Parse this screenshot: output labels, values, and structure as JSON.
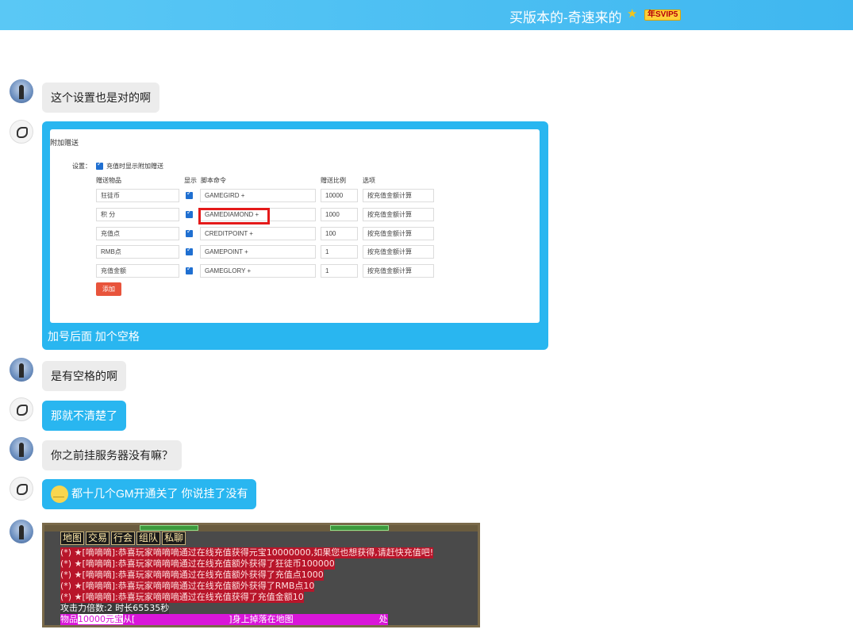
{
  "header": {
    "title": "买版本的-奇速来的",
    "vip_badge": "年SVIP5"
  },
  "messages": {
    "m1": "这个设置也是对的啊",
    "m2_caption": "加号后面 加个空格",
    "m3": "是有空格的啊",
    "m4": "那就不清楚了",
    "m5": "你之前挂服务器没有嘛？",
    "m6": "都十几个GM开通关了 你说挂了没有"
  },
  "screenshot_form": {
    "section_title": "附加赠送",
    "setting_label": "设置：",
    "setting_option": "充值时显示附加赠送",
    "col_item": "赠送物品",
    "col_show": "显示",
    "col_script": "脚本命令",
    "col_ratio": "赠送比例",
    "col_option": "选项",
    "rows": [
      {
        "item": "狂徒币",
        "script": "GAMEGIRD +",
        "ratio": "10000",
        "option": "按充值金额计算"
      },
      {
        "item": "积 分",
        "script": "GAMEDIAMOND +",
        "ratio": "1000",
        "option": "按充值金额计算"
      },
      {
        "item": "充值点",
        "script": "CREDITPOINT +",
        "ratio": "100",
        "option": "按充值金额计算"
      },
      {
        "item": "RMB点",
        "script": "GAMEPOINT +",
        "ratio": "1",
        "option": "按充值金额计算"
      },
      {
        "item": "充值金额",
        "script": "GAMEGLORY +",
        "ratio": "1",
        "option": "按充值金额计算"
      }
    ],
    "add_button": "添加"
  },
  "game_chat": {
    "tabs": [
      "地图",
      "交易",
      "行会",
      "组队",
      "私聊"
    ],
    "lines": [
      "(*) ★[嘀嘀嘀]:恭喜玩家嘀嘀嘀通过在线充值获得元宝10000000,如果您也想获得,请赶快充值吧!",
      "(*) ★[嘀嘀嘀]:恭喜玩家嘀嘀嘀通过在线充值额外获得了狂徒币100000",
      "(*) ★[嘀嘀嘀]:恭喜玩家嘀嘀嘀通过在线充值额外获得了充值点1000",
      "(*) ★[嘀嘀嘀]:恭喜玩家嘀嘀嘀通过在线充值额外获得了RMB点10",
      "(*) ★[嘀嘀嘀]:恭喜玩家嘀嘀嘀通过在线充值获得了充值金额10"
    ],
    "attack_line": "攻击力倍数:2 时长65535秒",
    "item_line_prefix": "物品",
    "item_line_value": "10000元宝",
    "item_line_mid": "从[",
    "item_line_drop": "]身上掉落在地图",
    "item_line_end": "处"
  },
  "colors": {
    "header": "#3fb7f0",
    "bubble_blue": "#29b6f0",
    "bubble_grey": "#ececec",
    "highlight_red": "#e41a1a"
  }
}
